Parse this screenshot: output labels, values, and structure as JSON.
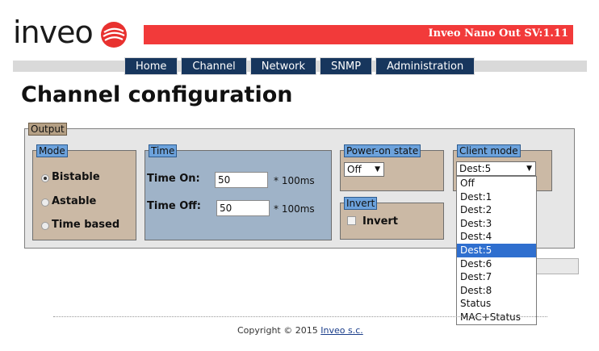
{
  "brand": {
    "logo_text": "inveo",
    "device_title": "Inveo Nano Out SV:1.11"
  },
  "colors": {
    "banner_red": "#f23a3a",
    "nav_blue": "#17365d",
    "legend_blue": "#6ca2dc",
    "legend_tan": "#b5a085",
    "selected_blue": "#2f6fcf"
  },
  "nav": {
    "tabs": [
      "Home",
      "Channel",
      "Network",
      "SNMP",
      "Administration"
    ]
  },
  "page": {
    "title": "Channel configuration"
  },
  "output": {
    "legend": "Output",
    "mode": {
      "legend": "Mode",
      "options": [
        "Bistable",
        "Astable",
        "Time based"
      ],
      "selected": "Bistable"
    },
    "time": {
      "legend": "Time",
      "on_label": "Time On:",
      "on_value": "50",
      "off_label": "Time Off:",
      "off_value": "50",
      "unit": "* 100ms"
    },
    "power_on_state": {
      "legend": "Power-on state",
      "value": "Off"
    },
    "invert": {
      "legend": "Invert",
      "label": "Invert"
    },
    "client_mode": {
      "legend": "Client mode",
      "value": "Dest:5",
      "options": [
        "Off",
        "Dest:1",
        "Dest:2",
        "Dest:3",
        "Dest:4",
        "Dest:5",
        "Dest:6",
        "Dest:7",
        "Dest:8",
        "Status",
        "MAC+Status"
      ]
    }
  },
  "footer": {
    "copyright": "Copyright © 2015",
    "link": "Inveo s.c."
  }
}
